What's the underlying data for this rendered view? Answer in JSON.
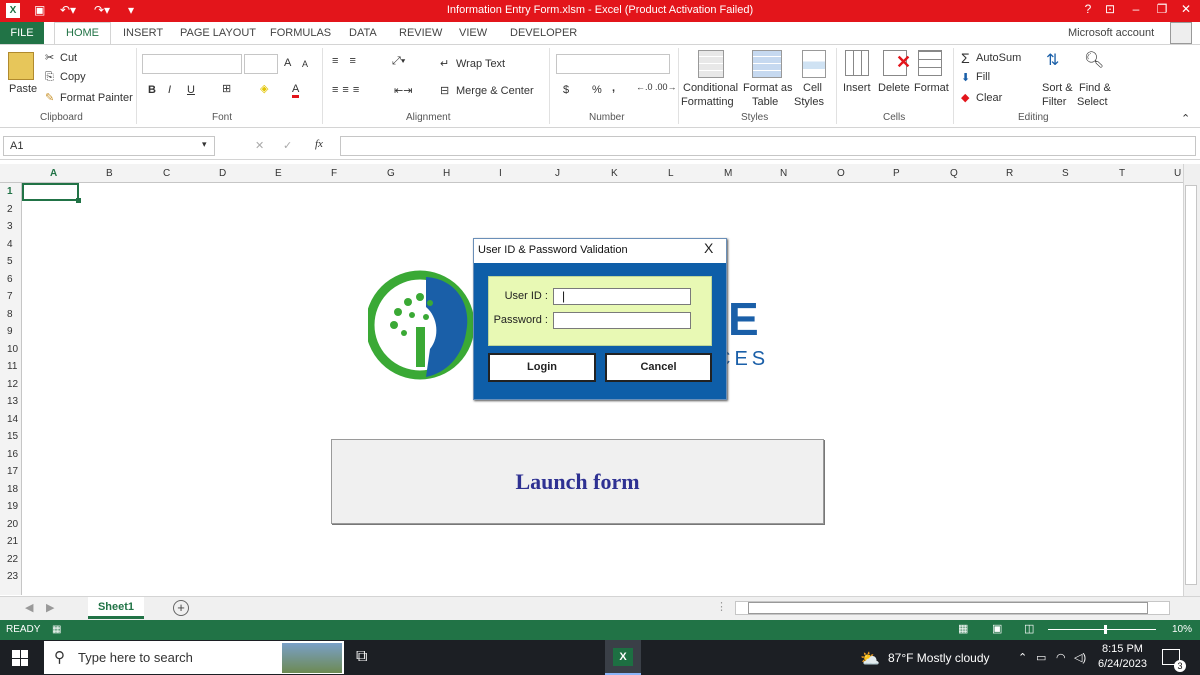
{
  "title_bar": {
    "title": "Information Entry Form.xlsm - Excel (Product Activation Failed)",
    "help": "?"
  },
  "ribbon_tabs": [
    "FILE",
    "HOME",
    "INSERT",
    "PAGE LAYOUT",
    "FORMULAS",
    "DATA",
    "REVIEW",
    "VIEW",
    "DEVELOPER"
  ],
  "account": "Microsoft account",
  "clipboard": {
    "paste": "Paste",
    "cut": "Cut",
    "copy": "Copy",
    "format_painter": "Format Painter",
    "group": "Clipboard"
  },
  "font": {
    "bold": "B",
    "italic": "I",
    "underline": "U",
    "grow": "A",
    "shrink": "A",
    "color": "A",
    "group": "Font"
  },
  "alignment": {
    "wrap": "Wrap Text",
    "merge": "Merge & Center",
    "group": "Alignment"
  },
  "number": {
    "currency": "$",
    "percent": "%",
    "comma": ",",
    "group": "Number"
  },
  "styles": {
    "conditional": "Conditional",
    "formatting": "Formatting",
    "format_as": "Format as",
    "table": "Table",
    "cell": "Cell",
    "cell_styles": "Styles",
    "group": "Styles"
  },
  "cells": {
    "insert": "Insert",
    "delete": "Delete",
    "format": "Format",
    "group": "Cells"
  },
  "editing": {
    "autosum": "AutoSum",
    "fill": "Fill",
    "clear": "Clear",
    "sort": "Sort &",
    "filter": "Filter",
    "find": "Find &",
    "select": "Select",
    "group": "Editing"
  },
  "name_box": "A1",
  "fx": "fx",
  "columns": [
    "A",
    "B",
    "C",
    "D",
    "E",
    "F",
    "G",
    "H",
    "I",
    "J",
    "K",
    "L",
    "M",
    "N",
    "O",
    "P",
    "Q",
    "R",
    "S",
    "T",
    "U"
  ],
  "rows": [
    "1",
    "2",
    "3",
    "4",
    "5",
    "6",
    "7",
    "8",
    "9",
    "10",
    "11",
    "12",
    "13",
    "14",
    "15",
    "16",
    "17",
    "18",
    "19",
    "20",
    "21",
    "22",
    "23"
  ],
  "launch_button": "Launch form",
  "logo_text": {
    "big": "E",
    "small": "CES"
  },
  "dialog": {
    "title": "User ID & Password Validation",
    "close": "X",
    "user_label": "User ID :",
    "user_value": "|",
    "password_label": "Password :",
    "login": "Login",
    "cancel": "Cancel"
  },
  "sheet_tab": "Sheet1",
  "add_sheet": "+",
  "status": {
    "ready": "READY",
    "zoom": "10%"
  },
  "taskbar": {
    "search_placeholder": "Type here to search",
    "weather": "87°F  Mostly cloudy",
    "time": "8:15 PM",
    "date": "6/24/2023",
    "notif_count": "3"
  },
  "colors": {
    "excel_green": "#217346",
    "title_red": "#e3151b",
    "dialog_blue": "#0e5ea8",
    "cred_bg": "#e8f9b4",
    "launch_text": "#2e3192"
  }
}
